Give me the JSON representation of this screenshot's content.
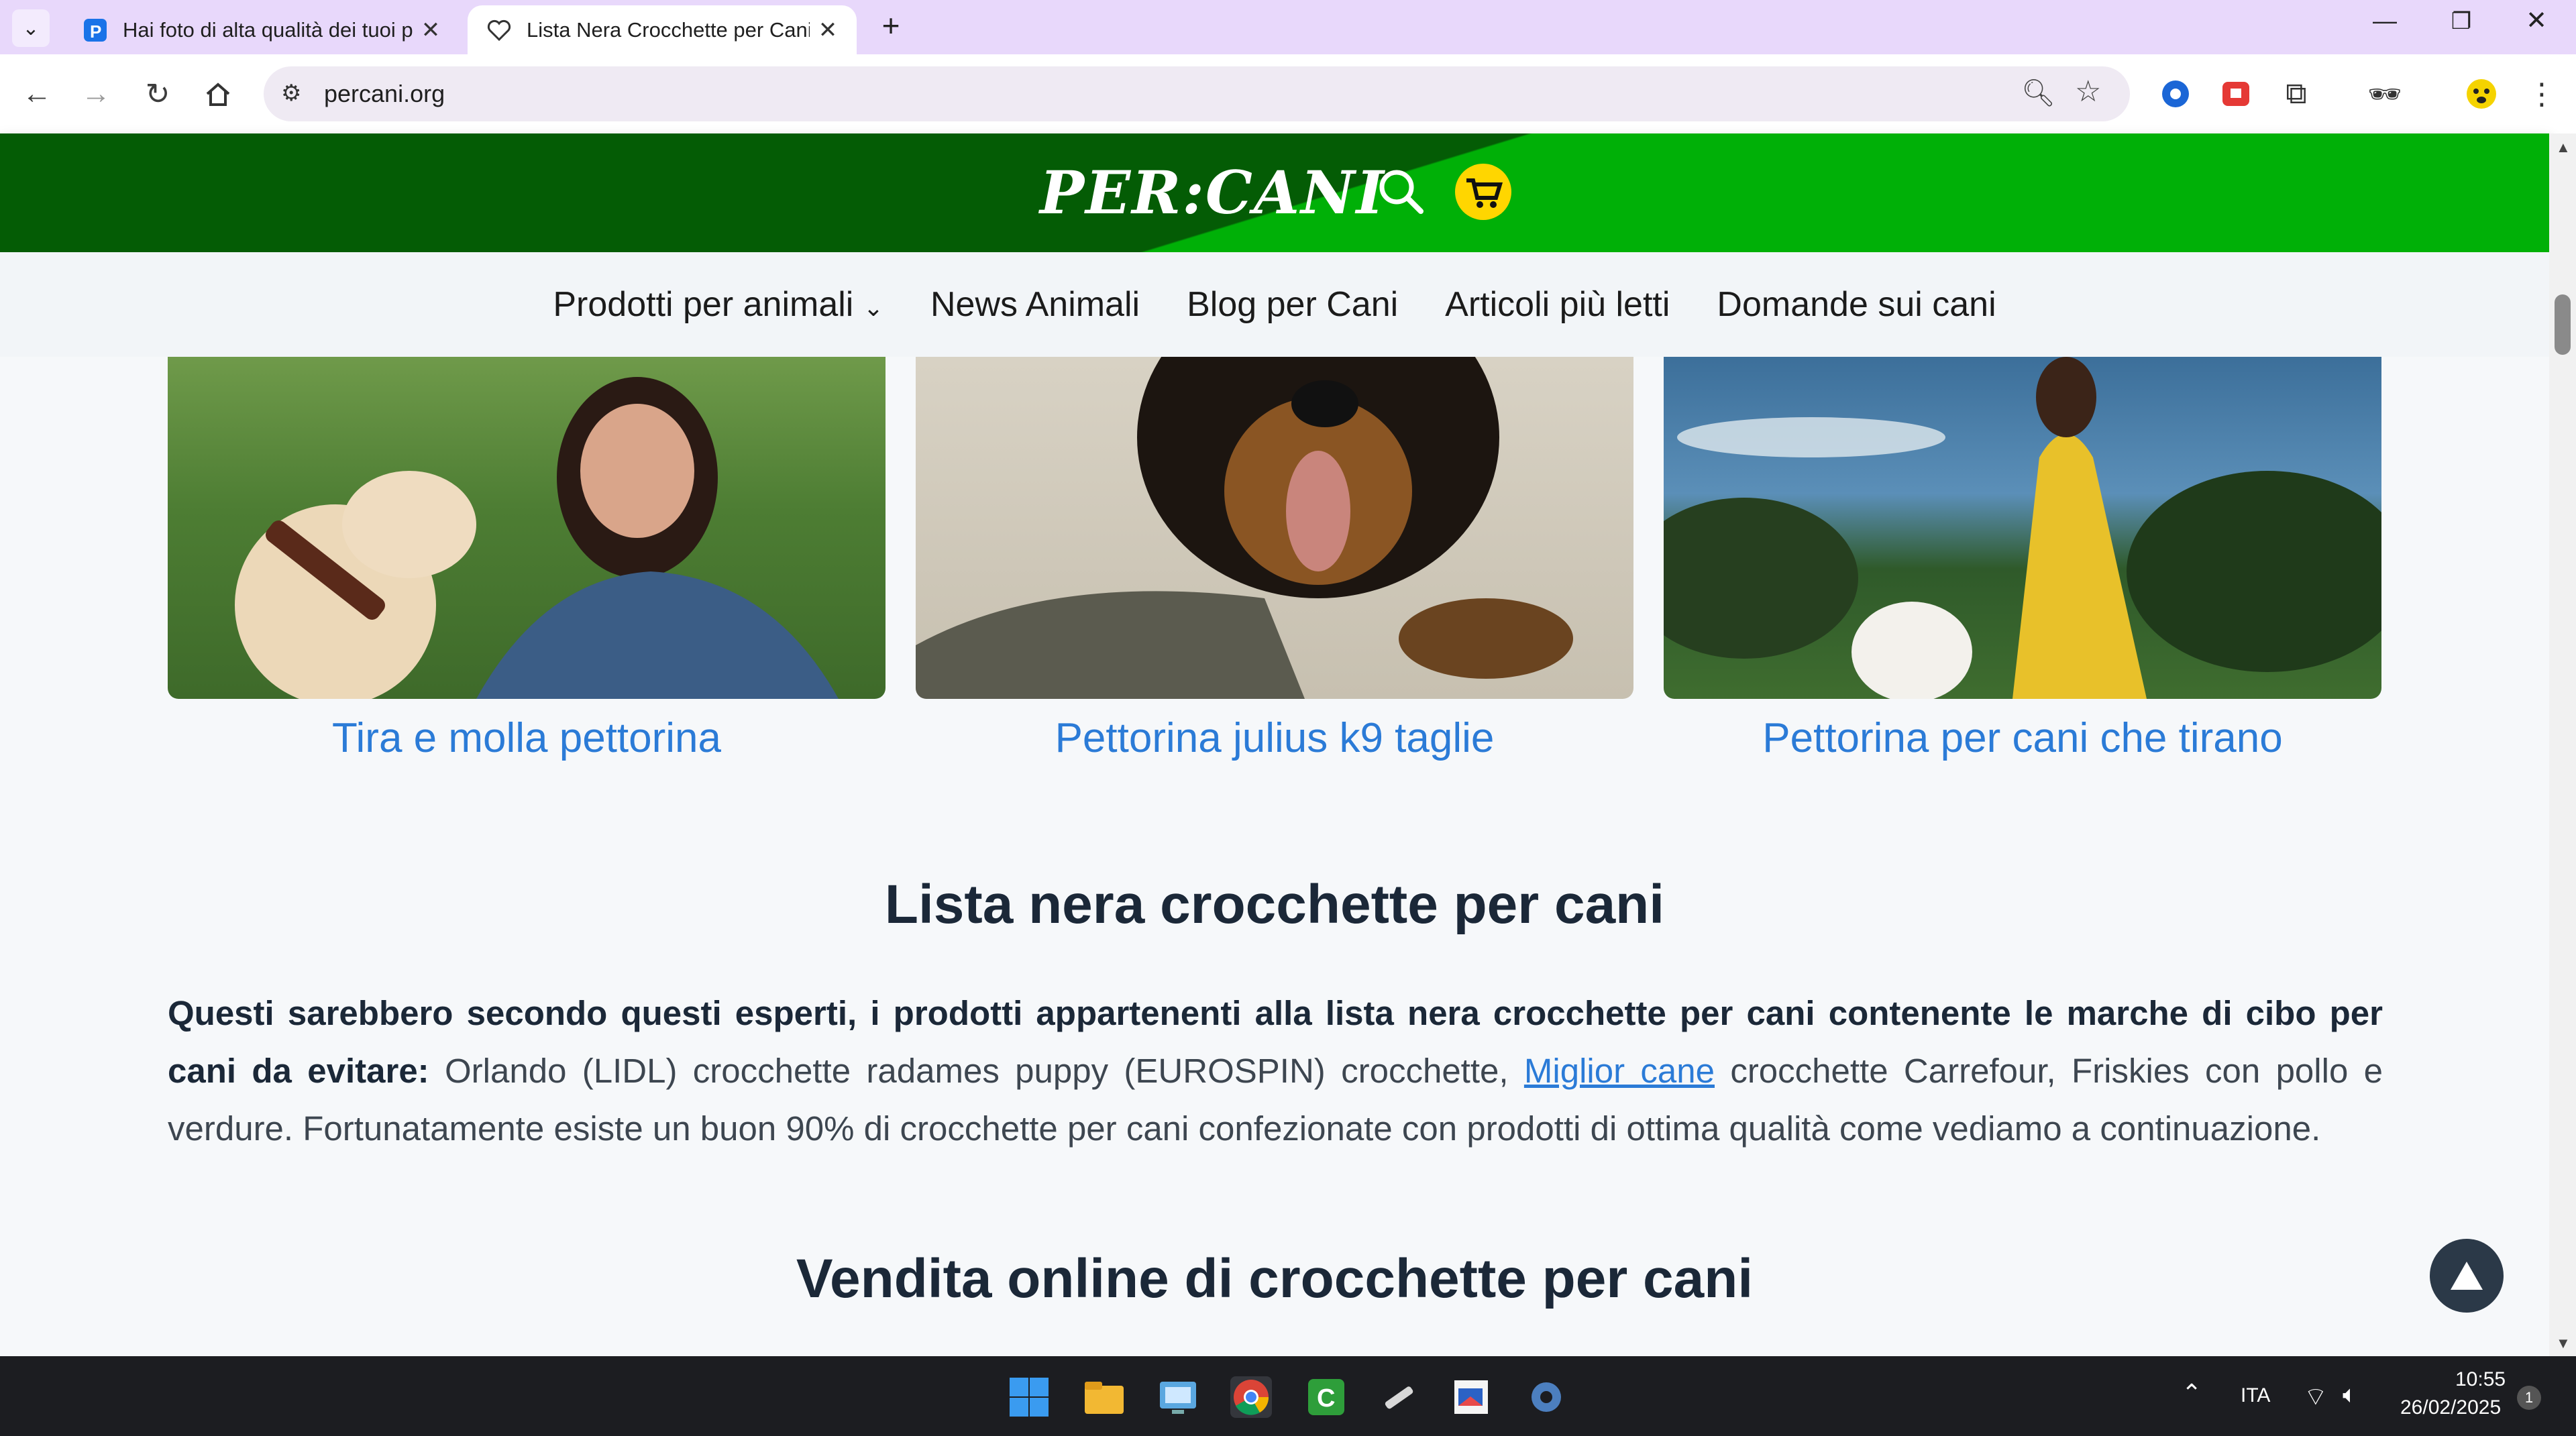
{
  "browser": {
    "tabs": [
      {
        "title": "Hai foto di alta qualità dei tuoi pe",
        "favicon": "p-icon",
        "active": false
      },
      {
        "title": "Lista Nera Crocchette per Cani: q",
        "favicon": "heart-paw-icon",
        "active": true
      }
    ],
    "new_tab_label": "+",
    "url": "percani.org"
  },
  "site": {
    "logo": "PER:CANI",
    "nav": [
      "Prodotti per animali",
      "News Animali",
      "Blog per Cani",
      "Articoli più letti",
      "Domande sui cani"
    ],
    "cards": [
      {
        "title": "Tira e molla pettorina"
      },
      {
        "title": "Pettorina julius k9 taglie"
      },
      {
        "title": "Pettorina per cani che tirano"
      }
    ],
    "section1": {
      "heading": "Lista nera crocchette per cani",
      "bold_intro": "Questi sarebbero secondo questi esperti, i prodotti appartenenti alla lista nera crocchette per cani contenente le marche di cibo per cani da evitare:",
      "text_before_link": " Orlando (LIDL) crocchette radames puppy (EUROSPIN) crocchette, ",
      "link_text": "Miglior cane",
      "text_after_link": " crocchette Carrefour, Friskies con pollo e verdure. Fortunatamente esiste un buon 90% di crocchette per cani confezionate con prodotti di ottima qualità come vediamo a continuazione."
    },
    "section2": {
      "heading": "Vendita online di crocchette per cani"
    }
  },
  "taskbar": {
    "language": "ITA",
    "time": "10:55",
    "date": "26/02/2025",
    "notification_count": "1"
  },
  "colors": {
    "header_dark": "#045c05",
    "header_light": "#00b007",
    "link_blue": "#2b7bd7",
    "tab_bar": "#e8d8fb"
  }
}
